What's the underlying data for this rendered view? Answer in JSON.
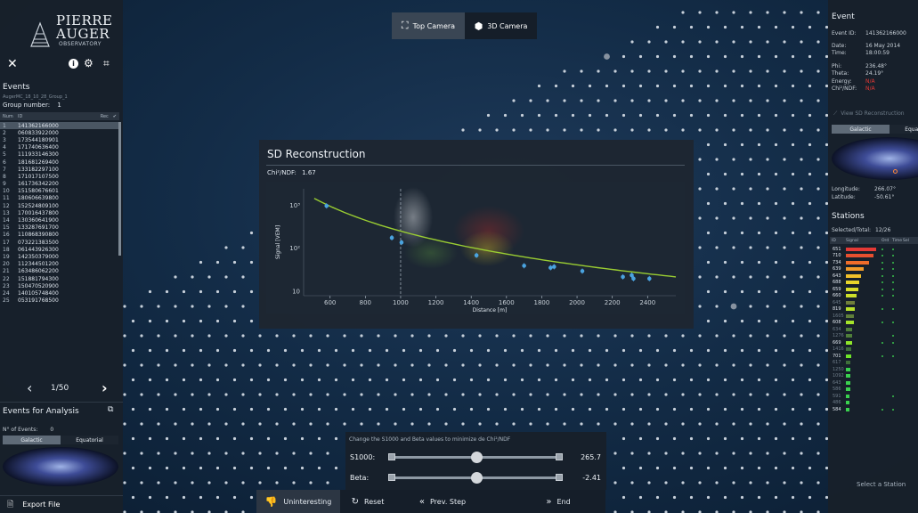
{
  "colors": {
    "accent": "#4aa3df",
    "fit_line": "#9acd32",
    "signal_red": "#e53935",
    "signal_green": "#3ad14e"
  },
  "camera": {
    "top_label": "Top Camera",
    "three_d_label": "3D Camera"
  },
  "logo": {
    "line1": "PIERRE",
    "line2": "AUGER",
    "line3": "OBSERVATORY"
  },
  "left": {
    "toolbar_icons": [
      "close-icon",
      "info-icon",
      "gear-icon",
      "crosshair-icon"
    ],
    "events_title": "Events",
    "file_label": "AugerMC_18_10_28_Group_1",
    "group_label": "Group number:",
    "group_value": "1",
    "col_num": "Num",
    "col_id": "ID",
    "col_rec": "Rec",
    "events": [
      [
        "1",
        "141362166000"
      ],
      [
        "2",
        "060833922000"
      ],
      [
        "3",
        "173544180901"
      ],
      [
        "4",
        "171740636400"
      ],
      [
        "5",
        "111933146300"
      ],
      [
        "6",
        "181681269400"
      ],
      [
        "7",
        "133182297100"
      ],
      [
        "8",
        "171017107500"
      ],
      [
        "9",
        "161736342200"
      ],
      [
        "10",
        "151580676601"
      ],
      [
        "11",
        "180606639800"
      ],
      [
        "12",
        "152524809100"
      ],
      [
        "13",
        "170016437800"
      ],
      [
        "14",
        "130360641900"
      ],
      [
        "15",
        "133287691700"
      ],
      [
        "16",
        "110868390800"
      ],
      [
        "17",
        "073221383500"
      ],
      [
        "18",
        "061443926300"
      ],
      [
        "19",
        "142350379000"
      ],
      [
        "20",
        "112344501200"
      ],
      [
        "21",
        "163486062200"
      ],
      [
        "22",
        "151881794300"
      ],
      [
        "23",
        "150470520900"
      ],
      [
        "24",
        "140105748400"
      ],
      [
        "25",
        "053191768500"
      ]
    ],
    "page": "1/50",
    "analysis_title": "Events for Analysis",
    "n_events_label": "N° of Events:",
    "n_events_value": "0",
    "tab_galactic": "Galactic",
    "tab_equatorial": "Equatorial",
    "export": "Export File"
  },
  "sd": {
    "title": "SD Reconstruction",
    "chi_label": "Chi²/NDF:",
    "chi_value": "1.67",
    "ylabel": "Signal [VEM]",
    "xlabel": "Distance [m]"
  },
  "chart_data": {
    "type": "scatter",
    "title": "SD Reconstruction",
    "xlabel": "Distance [m]",
    "ylabel": "Signal [VEM]",
    "x_ticks": [
      600,
      800,
      1000,
      1200,
      1400,
      1600,
      1800,
      2000,
      2200,
      2400
    ],
    "y_ticks": [
      "10³",
      "10²",
      "10"
    ],
    "xlim": [
      450,
      2560
    ],
    "y_log": true,
    "reference_line_x": 1000,
    "points": [
      {
        "x": 580,
        "y": 1000
      },
      {
        "x": 950,
        "y": 180
      },
      {
        "x": 1005,
        "y": 140
      },
      {
        "x": 1430,
        "y": 70
      },
      {
        "x": 1700,
        "y": 40
      },
      {
        "x": 1850,
        "y": 36
      },
      {
        "x": 1870,
        "y": 38
      },
      {
        "x": 2030,
        "y": 30
      },
      {
        "x": 2260,
        "y": 22
      },
      {
        "x": 2310,
        "y": 24
      },
      {
        "x": 2320,
        "y": 20
      },
      {
        "x": 2410,
        "y": 20
      }
    ],
    "fit": {
      "name": "",
      "x": [
        510,
        2560
      ],
      "y": [
        1500,
        22
      ]
    }
  },
  "sliders": {
    "hint": "Change the S1000 and Beta values to minimize de Chi²/NDF",
    "s1000_label": "S1000:",
    "s1000_value": "265.7",
    "s1000_fraction": 0.5,
    "beta_label": "Beta:",
    "beta_value": "-2.41",
    "beta_fraction": 0.5
  },
  "bottom": {
    "uninteresting": "Uninteresting",
    "reset": "Reset",
    "prev": "Prev. Step",
    "end": "End"
  },
  "right": {
    "event_title": "Event",
    "event_id_label": "Event ID:",
    "event_id_value": "141362166000",
    "date_label": "Date:",
    "date_value": "16 May 2014",
    "time_label": "Time:",
    "time_value": "18:00:59",
    "phi_label": "Phi:",
    "phi_value": "236.48°",
    "theta_label": "Theta:",
    "theta_value": "24.19°",
    "energy_label": "Energy:",
    "energy_value": "N/A",
    "chi_label": "Chi²/NDF:",
    "chi_value": "N/A",
    "view_sd": "View SD Reconstruction",
    "tab_galactic": "Galactic",
    "tab_equatorial": "Equatorial",
    "longitude_label": "Longitude:",
    "longitude_value": "266.07°",
    "latitude_label": "Latitude:",
    "latitude_value": "-50.61°",
    "stations_title": "Stations",
    "selected_label": "Selected/Total:",
    "selected_value": "12/26",
    "col_id": "ID",
    "col_signal": "Signal",
    "col_ord": "Ord",
    "col_time": "Time",
    "col_sel": "Sel",
    "stations": [
      {
        "id": "651",
        "frac": 1.0,
        "color": "#e53935",
        "ord": 1,
        "time": 1
      },
      {
        "id": "710",
        "frac": 0.9,
        "color": "#e8502f",
        "ord": 1,
        "time": 1
      },
      {
        "id": "734",
        "frac": 0.75,
        "color": "#ef6c2a",
        "ord": 1,
        "time": 1
      },
      {
        "id": "639",
        "frac": 0.6,
        "color": "#f09a2a",
        "ord": 1,
        "time": 1
      },
      {
        "id": "643",
        "frac": 0.5,
        "color": "#f1c02a",
        "ord": 1,
        "time": 1
      },
      {
        "id": "688",
        "frac": 0.45,
        "color": "#e8d52a",
        "ord": 1,
        "time": 1
      },
      {
        "id": "659",
        "frac": 0.4,
        "color": "#d8dc2a",
        "ord": 1,
        "time": 1
      },
      {
        "id": "660",
        "frac": 0.35,
        "color": "#cde02a",
        "ord": 1,
        "time": 1
      },
      {
        "id": "645",
        "frac": 0.3,
        "color": "#6f7f3a",
        "ord": 0,
        "time": 0
      },
      {
        "id": "819",
        "frac": 0.3,
        "color": "#b9e22a",
        "ord": 1,
        "time": 1
      },
      {
        "id": "1605",
        "frac": 0.25,
        "color": "#5f7f3a",
        "ord": 0,
        "time": 0
      },
      {
        "id": "608",
        "frac": 0.25,
        "color": "#a5e52a",
        "ord": 1,
        "time": 1
      },
      {
        "id": "634",
        "frac": 0.22,
        "color": "#4f7f3a",
        "ord": 0,
        "time": 0
      },
      {
        "id": "1276",
        "frac": 0.22,
        "color": "#4f7f3a",
        "ord": 0,
        "time": 1
      },
      {
        "id": "669",
        "frac": 0.2,
        "color": "#8fe62a",
        "ord": 1,
        "time": 1
      },
      {
        "id": "1416",
        "frac": 0.18,
        "color": "#3f6f3a",
        "ord": 0,
        "time": 0
      },
      {
        "id": "701",
        "frac": 0.18,
        "color": "#6fe52a",
        "ord": 1,
        "time": 1
      },
      {
        "id": "617",
        "frac": 0.16,
        "color": "#3f6f3a",
        "ord": 0,
        "time": 0
      },
      {
        "id": "1250",
        "frac": 0.16,
        "color": "#3ad14e",
        "ord": 0,
        "time": 0
      },
      {
        "id": "1092",
        "frac": 0.15,
        "color": "#3ad14e",
        "ord": 0,
        "time": 0
      },
      {
        "id": "643",
        "frac": 0.14,
        "color": "#3ad14e",
        "ord": 0,
        "time": 0
      },
      {
        "id": "586",
        "frac": 0.14,
        "color": "#3ad14e",
        "ord": 0,
        "time": 0
      },
      {
        "id": "591",
        "frac": 0.13,
        "color": "#3ad14e",
        "ord": 0,
        "time": 1
      },
      {
        "id": "486",
        "frac": 0.12,
        "color": "#3ad14e",
        "ord": 0,
        "time": 0
      },
      {
        "id": "584",
        "frac": 0.12,
        "color": "#3ad14e",
        "ord": 1,
        "time": 1
      }
    ],
    "select_station": "Select a Station"
  }
}
